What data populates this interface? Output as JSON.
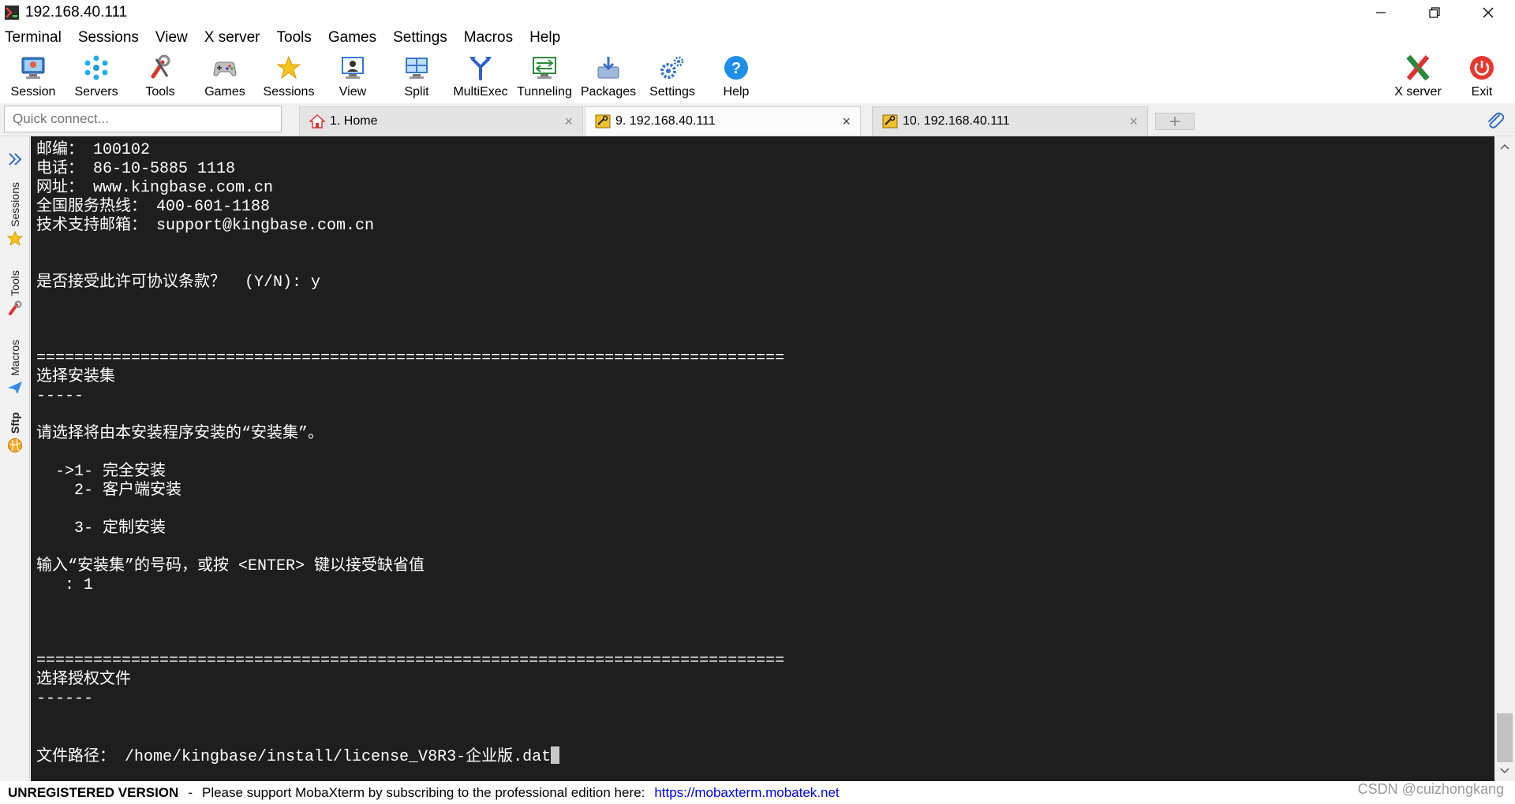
{
  "window": {
    "title": "192.168.40.111"
  },
  "menu": [
    "Terminal",
    "Sessions",
    "View",
    "X server",
    "Tools",
    "Games",
    "Settings",
    "Macros",
    "Help"
  ],
  "toolbar": {
    "session": "Session",
    "servers": "Servers",
    "tools": "Tools",
    "games": "Games",
    "sessions": "Sessions",
    "view": "View",
    "split": "Split",
    "multiexec": "MultiExec",
    "tunneling": "Tunneling",
    "packages": "Packages",
    "settings": "Settings",
    "help": "Help",
    "xserver": "X server",
    "exit": "Exit"
  },
  "quick_connect": {
    "placeholder": "Quick connect..."
  },
  "tabs": [
    {
      "label": "1. Home",
      "active": false
    },
    {
      "label": "9. 192.168.40.111",
      "active": true
    },
    {
      "label": "10. 192.168.40.111",
      "active": false
    }
  ],
  "sidebar": {
    "sessions": "Sessions",
    "tools": "Tools",
    "macros": "Macros",
    "sftp": "Sftp"
  },
  "terminal": {
    "lines": [
      "邮编： 100102",
      "电话： 86-10-5885 1118",
      "网址： www.kingbase.com.cn",
      "全国服务热线： 400-601-1188",
      "技术支持邮箱： support@kingbase.com.cn",
      "",
      "",
      "是否接受此许可协议条款？  (Y/N): y",
      "",
      "",
      "",
      "===============================================================================",
      "选择安装集",
      "-----",
      "",
      "请选择将由本安装程序安装的“安装集”。",
      "",
      "  ->1- 完全安装",
      "    2- 客户端安装",
      "",
      "    3- 定制安装",
      "",
      "输入“安装集”的号码，或按 <ENTER> 键以接受缺省值",
      "   : 1",
      "",
      "",
      "",
      "===============================================================================",
      "选择授权文件",
      "------",
      "",
      "",
      "文件路径： /home/kingbase/install/license_V8R3-企业版.dat"
    ]
  },
  "status": {
    "unregistered": "UNREGISTERED VERSION",
    "separator": "-",
    "support_text": "Please support MobaXterm by subscribing to the professional edition here:",
    "link": "https://mobaxterm.mobatek.net",
    "watermark": "CSDN @cuizhongkang"
  }
}
